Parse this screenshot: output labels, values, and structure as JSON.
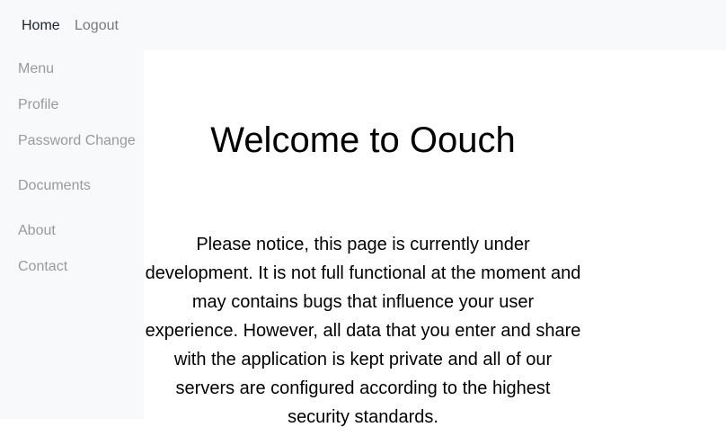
{
  "topnav": {
    "home_label": "Home",
    "logout_label": "Logout"
  },
  "sidebar": {
    "items": [
      {
        "label": "Menu"
      },
      {
        "label": "Profile"
      },
      {
        "label": "Password Change"
      },
      {
        "label": "Documents"
      },
      {
        "label": "About"
      },
      {
        "label": "Contact"
      }
    ]
  },
  "main": {
    "title": "Welcome to Oouch",
    "notice": "Please notice, this page is currently under development. It is not full functional at the moment and may contains bugs that influence your user experience. However, all data that you enter and share with the application is kept private and all of our servers are configured according to the highest security standards."
  },
  "colors": {
    "nav_background": "#f8f9fa",
    "active_link": "#212529",
    "muted_link": "#9a9a9a"
  }
}
